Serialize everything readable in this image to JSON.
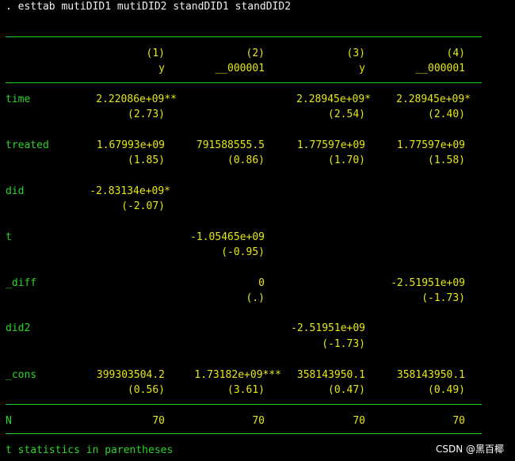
{
  "command": ". esttab mutiDID1 mutiDID2 standDID1 standDID2",
  "header": {
    "col_numbers": [
      "(1)",
      "(2)",
      "(3)",
      "(4)"
    ],
    "col_depvars": [
      "y",
      "__000001",
      "y",
      "__000001"
    ]
  },
  "rows": [
    {
      "label": "time",
      "coefs": [
        "2.22086e+09**",
        "",
        "2.28945e+09*",
        "2.28945e+09*"
      ],
      "tstats": [
        "(2.73)",
        "",
        "(2.54)",
        "(2.40)"
      ]
    },
    {
      "label": "treated",
      "coefs": [
        "1.67993e+09",
        "791588555.5",
        "1.77597e+09",
        "1.77597e+09"
      ],
      "tstats": [
        "(1.85)",
        "(0.86)",
        "(1.70)",
        "(1.58)"
      ]
    },
    {
      "label": "did",
      "coefs": [
        "-2.83134e+09*",
        "",
        "",
        ""
      ],
      "tstats": [
        "(-2.07)",
        "",
        "",
        ""
      ]
    },
    {
      "label": "t",
      "coefs": [
        "",
        "-1.05465e+09",
        "",
        ""
      ],
      "tstats": [
        "",
        "(-0.95)",
        "",
        ""
      ]
    },
    {
      "label": "_diff",
      "coefs": [
        "",
        "0",
        "",
        "-2.51951e+09"
      ],
      "tstats": [
        "",
        "(.)",
        "",
        "(-1.73)"
      ]
    },
    {
      "label": "did2",
      "coefs": [
        "",
        "",
        "-2.51951e+09",
        ""
      ],
      "tstats": [
        "",
        "",
        "(-1.73)",
        ""
      ]
    },
    {
      "label": "_cons",
      "coefs": [
        "399303504.2",
        "1.73182e+09***",
        "358143950.1",
        "358143950.1"
      ],
      "tstats": [
        "(0.56)",
        "(3.61)",
        "(0.47)",
        "(0.49)"
      ]
    }
  ],
  "n_row": {
    "label": "N",
    "values": [
      "70",
      "70",
      "70",
      "70"
    ]
  },
  "footnote": "t statistics in parentheses",
  "watermark": "CSDN @黑百椰",
  "colors": {
    "label": "#2cd42c",
    "number": "#e6e614",
    "rule": "#1fd01f",
    "command": "#f0f0f0",
    "background": "#000000"
  }
}
